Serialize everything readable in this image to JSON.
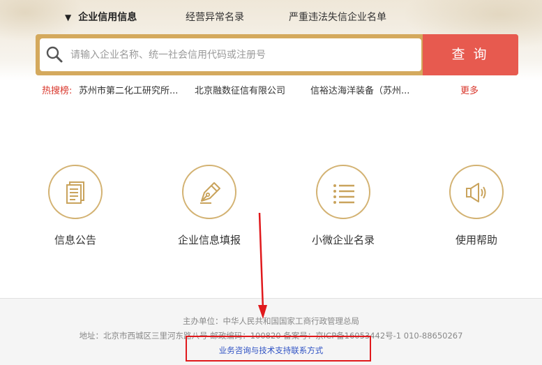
{
  "nav": {
    "tabs": [
      {
        "label": "企业信用信息",
        "active": true
      },
      {
        "label": "经营异常名录",
        "active": false
      },
      {
        "label": "严重违法失信企业名单",
        "active": false
      }
    ],
    "active_marker": "▼"
  },
  "search": {
    "placeholder": "请输入企业名称、统一社会信用代码或注册号",
    "button_label": "查询",
    "icon": "magnifier-icon"
  },
  "hot_search": {
    "label": "热搜榜:",
    "items": [
      "苏州市第二化工研究所...",
      "北京融数征信有限公司",
      "信裕达海洋装备（苏州..."
    ],
    "more_label": "更多"
  },
  "entries": [
    {
      "label": "信息公告",
      "icon": "document-icon"
    },
    {
      "label": "企业信息填报",
      "icon": "pen-nib-icon"
    },
    {
      "label": "小微企业名录",
      "icon": "list-icon"
    },
    {
      "label": "使用帮助",
      "icon": "megaphone-icon"
    }
  ],
  "footer": {
    "sponsor": "主办单位：中华人民共和国国家工商行政管理总局",
    "address": "地址：北京市西城区三里河东路八号   邮政编码：100820   备案号：京ICP备16053442号-1   010-88650267",
    "contact_link": "业务咨询与技术支持联系方式"
  },
  "colors": {
    "accent_gold": "#d4a95d",
    "search_button": "#e75a4f",
    "hot_red": "#d9362b",
    "link_blue": "#2f52c4",
    "annotation_red": "#e0191c"
  }
}
